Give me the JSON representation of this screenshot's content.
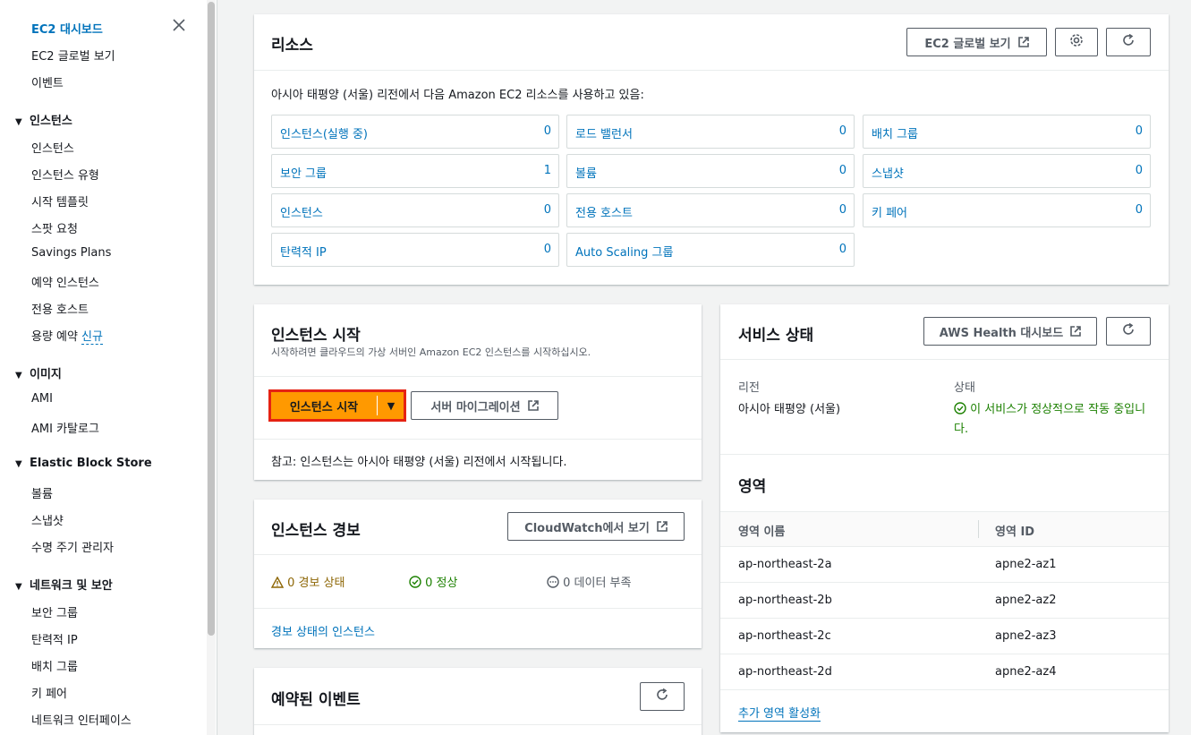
{
  "sidebar": {
    "top_links": [
      "EC2 대시보드",
      "EC2 글로벌 보기",
      "이벤트"
    ],
    "groups": [
      {
        "title": "인스턴스",
        "items": [
          "인스턴스",
          "인스턴스 유형",
          "시작 템플릿",
          "스팟 요청",
          "Savings Plans",
          "예약 인스턴스",
          "전용 호스트",
          "용량 예약"
        ]
      },
      {
        "title": "이미지",
        "items": [
          "AMI",
          "AMI 카탈로그"
        ]
      },
      {
        "title": "Elastic Block Store",
        "items": [
          "볼륨",
          "스냅샷",
          "수명 주기 관리자"
        ]
      },
      {
        "title": "네트워크 및 보안",
        "items": [
          "보안 그룹",
          "탄력적 IP",
          "배치 그룹",
          "키 페어",
          "네트워크 인터페이스"
        ]
      }
    ],
    "new_badge": "신규"
  },
  "resources": {
    "title": "리소스",
    "global_view_btn": "EC2 글로벌 보기",
    "description": "아시아 태평양 (서울) 리전에서 다음 Amazon EC2 리소스를 사용하고 있음:",
    "items": [
      {
        "label": "인스턴스(실행 중)",
        "value": "0"
      },
      {
        "label": "로드 밸런서",
        "value": "0"
      },
      {
        "label": "배치 그룹",
        "value": "0"
      },
      {
        "label": "보안 그룹",
        "value": "1"
      },
      {
        "label": "볼륨",
        "value": "0"
      },
      {
        "label": "스냅샷",
        "value": "0"
      },
      {
        "label": "인스턴스",
        "value": "0"
      },
      {
        "label": "전용 호스트",
        "value": "0"
      },
      {
        "label": "키 페어",
        "value": "0"
      },
      {
        "label": "탄력적 IP",
        "value": "0"
      },
      {
        "label": "Auto Scaling 그룹",
        "value": "0"
      }
    ]
  },
  "launch": {
    "title": "인스턴스 시작",
    "subtitle": "시작하려면 클라우드의 가상 서버인 Amazon EC2 인스턴스를 시작하십시오.",
    "launch_btn": "인스턴스 시작",
    "migrate_btn": "서버 마이그레이션",
    "note": "참고: 인스턴스는 아시아 태평양 (서울) 리전에서 시작됩니다."
  },
  "alarms": {
    "title": "인스턴스 경보",
    "cloudwatch_btn": "CloudWatch에서 보기",
    "alarm_state": "0 경보 상태",
    "ok_state": "0 정상",
    "insufficient": "0 데이터 부족",
    "link": "경보 상태의 인스턴스"
  },
  "events": {
    "title": "예약된 이벤트"
  },
  "service_health": {
    "title": "서비스 상태",
    "dashboard_btn": "AWS Health 대시보드",
    "region_label": "리전",
    "region_value": "아시아 태평양 (서울)",
    "status_label": "상태",
    "status_line1": "이 서비스가 정상적으로 작동 중입니",
    "status_line2": "다."
  },
  "zones": {
    "title": "영역",
    "col_name": "영역 이름",
    "col_id": "영역 ID",
    "rows": [
      {
        "name": "ap-northeast-2a",
        "id": "apne2-az1"
      },
      {
        "name": "ap-northeast-2b",
        "id": "apne2-az2"
      },
      {
        "name": "ap-northeast-2c",
        "id": "apne2-az3"
      },
      {
        "name": "ap-northeast-2d",
        "id": "apne2-az4"
      }
    ],
    "enable_link": "추가 영역 활성화"
  },
  "colors": {
    "link": "#0073bb",
    "accent": "#ff9900",
    "highlight": "#e52213",
    "ok": "#1d8102",
    "warn": "#8d6605"
  }
}
